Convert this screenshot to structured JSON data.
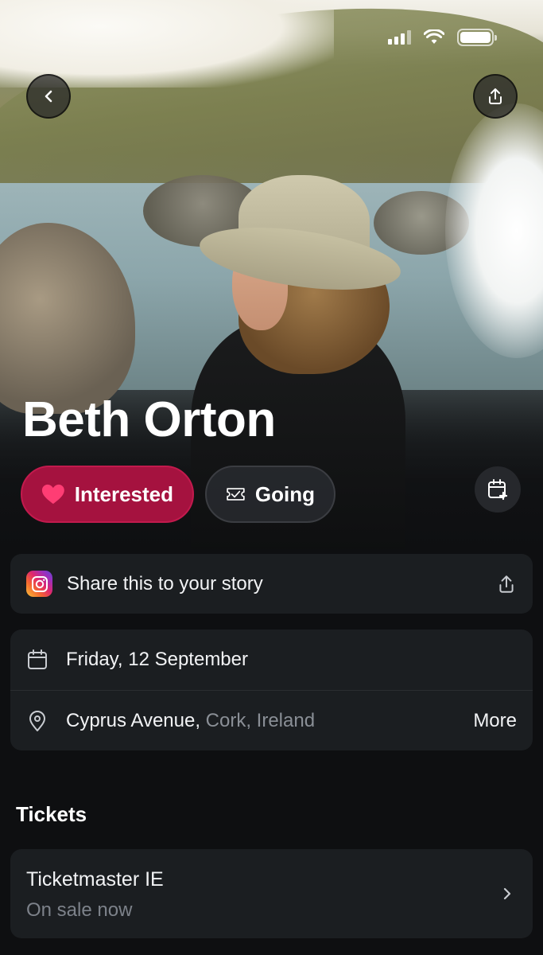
{
  "event": {
    "title": "Beth Orton"
  },
  "actions": {
    "interested_label": "Interested",
    "going_label": "Going"
  },
  "share_story": {
    "label": "Share this to your story"
  },
  "details": {
    "date": "Friday, 12 September",
    "venue": "Cyprus Avenue,",
    "location": " Cork, Ireland",
    "more_label": "More"
  },
  "tickets": {
    "section_title": "Tickets",
    "provider": "Ticketmaster IE",
    "status": "On sale now"
  },
  "colors": {
    "interested": "#a5123f",
    "background": "#0e0f11",
    "card": "#1b1e21"
  },
  "icons": [
    "back-icon",
    "share-icon",
    "heart-icon",
    "ticket-check-icon",
    "calendar-plus-icon",
    "instagram-icon",
    "calendar-icon",
    "location-pin-icon",
    "chevron-right-icon"
  ]
}
